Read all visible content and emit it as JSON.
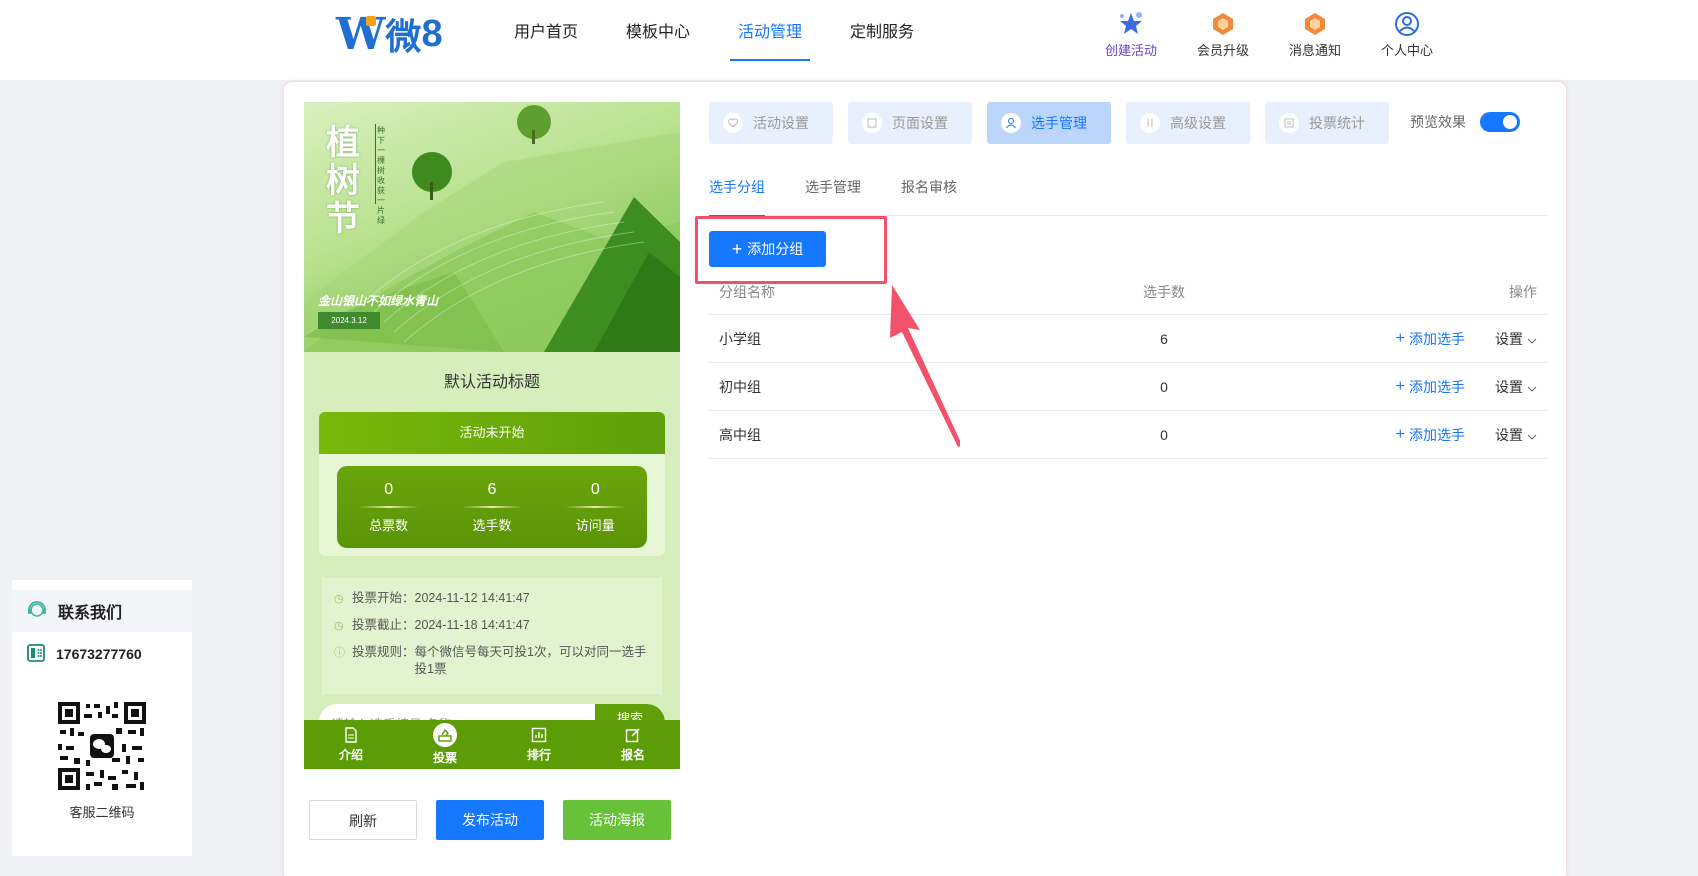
{
  "brand": {
    "logo_text": "W",
    "logo_char": "微",
    "logo_num": "8"
  },
  "nav": [
    {
      "label": "用户首页",
      "active": false
    },
    {
      "label": "模板中心",
      "active": false
    },
    {
      "label": "活动管理",
      "active": true
    },
    {
      "label": "定制服务",
      "active": false
    }
  ],
  "top_actions": [
    {
      "label": "创建活动",
      "icon": "star-cluster-icon"
    },
    {
      "label": "会员升级",
      "icon": "vip-gem-icon"
    },
    {
      "label": "消息通知",
      "icon": "notification-gem-icon"
    },
    {
      "label": "个人中心",
      "icon": "user-circle-icon"
    }
  ],
  "preview": {
    "banner_title": "植树节",
    "banner_subtitle": "种下一棵树 收获一片绿",
    "banner_slogan": "金山银山不如绿水青山",
    "banner_date": "2024.3.12",
    "activity_title": "默认活动标题",
    "status": "活动未开始",
    "stats": [
      {
        "value": "0",
        "label": "总票数"
      },
      {
        "value": "6",
        "label": "选手数"
      },
      {
        "value": "0",
        "label": "访问量"
      }
    ],
    "info": [
      {
        "key": "投票开始：",
        "value": "2024-11-12 14:41:47"
      },
      {
        "key": "投票截止：",
        "value": "2024-11-18 14:41:47"
      },
      {
        "key": "投票规则：",
        "value": "每个微信号每天可投1次，可以对同一选手投1票"
      }
    ],
    "search_placeholder": "请输入选手编号/名称",
    "search_button": "搜索",
    "tabs": [
      {
        "label": "介绍",
        "icon": "document-icon",
        "active": false
      },
      {
        "label": "投票",
        "icon": "vote-icon",
        "active": true
      },
      {
        "label": "排行",
        "icon": "chart-icon",
        "active": false
      },
      {
        "label": "报名",
        "icon": "edit-icon",
        "active": false
      }
    ]
  },
  "preview_buttons": {
    "refresh": "刷新",
    "publish": "发布活动",
    "poster": "活动海报"
  },
  "steps": [
    {
      "label": "活动设置",
      "active": false
    },
    {
      "label": "页面设置",
      "active": false
    },
    {
      "label": "选手管理",
      "active": true
    },
    {
      "label": "高级设置",
      "active": false
    },
    {
      "label": "投票统计",
      "active": false
    }
  ],
  "preview_toggle": {
    "label": "预览效果",
    "on": true
  },
  "subtabs": [
    {
      "label": "选手分组",
      "active": true
    },
    {
      "label": "选手管理",
      "active": false
    },
    {
      "label": "报名审核",
      "active": false
    }
  ],
  "add_group_label": "添加分组",
  "table": {
    "headers": {
      "name": "分组名称",
      "count": "选手数",
      "ops": "操作"
    },
    "rows": [
      {
        "name": "小学组",
        "count": "6",
        "add": "添加选手",
        "settings": "设置"
      },
      {
        "name": "初中组",
        "count": "0",
        "add": "添加选手",
        "settings": "设置"
      },
      {
        "name": "高中组",
        "count": "0",
        "add": "添加选手",
        "settings": "设置"
      }
    ]
  },
  "contact": {
    "title": "联系我们",
    "phone": "17673277760",
    "qr_label": "客服二维码"
  },
  "colors": {
    "primary": "#1677ff",
    "highlight": "#f2516a",
    "preview_green": "#5c9d07",
    "poster_green": "#67c23a"
  }
}
